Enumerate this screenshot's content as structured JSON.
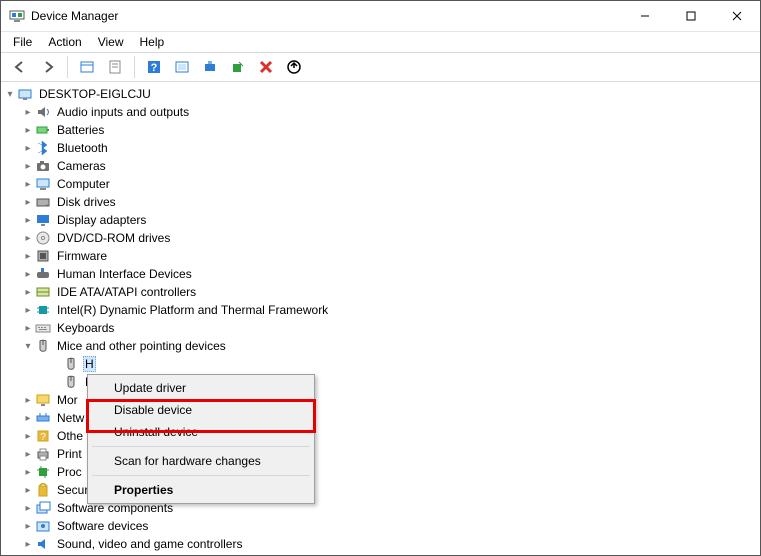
{
  "window": {
    "title": "Device Manager"
  },
  "menubar": [
    "File",
    "Action",
    "View",
    "Help"
  ],
  "toolbar_icons": [
    "back",
    "forward",
    "show-hidden",
    "properties",
    "help",
    "refresh",
    "update-driver",
    "scan",
    "uninstall",
    "safely-remove"
  ],
  "root_node": "DESKTOP-EIGLCJU",
  "categories": [
    {
      "label": "Audio inputs and outputs",
      "icon": "speaker",
      "expandable": true
    },
    {
      "label": "Batteries",
      "icon": "battery",
      "expandable": true
    },
    {
      "label": "Bluetooth",
      "icon": "bluetooth",
      "expandable": true
    },
    {
      "label": "Cameras",
      "icon": "camera",
      "expandable": true
    },
    {
      "label": "Computer",
      "icon": "computer",
      "expandable": true
    },
    {
      "label": "Disk drives",
      "icon": "disk",
      "expandable": true
    },
    {
      "label": "Display adapters",
      "icon": "display",
      "expandable": true
    },
    {
      "label": "DVD/CD-ROM drives",
      "icon": "cd",
      "expandable": true
    },
    {
      "label": "Firmware",
      "icon": "firmware",
      "expandable": true
    },
    {
      "label": "Human Interface Devices",
      "icon": "hid",
      "expandable": true
    },
    {
      "label": "IDE ATA/ATAPI controllers",
      "icon": "ide",
      "expandable": true
    },
    {
      "label": "Intel(R) Dynamic Platform and Thermal Framework",
      "icon": "chip",
      "expandable": true
    },
    {
      "label": "Keyboards",
      "icon": "keyboard",
      "expandable": true
    },
    {
      "label": "Mice and other pointing devices",
      "icon": "mouse",
      "expandable": true,
      "expanded": true,
      "children": [
        {
          "label": "H",
          "icon": "mouse",
          "selected": true
        },
        {
          "label": "P",
          "icon": "mouse"
        }
      ]
    },
    {
      "label": "Mor",
      "icon": "monitor",
      "expandable": true
    },
    {
      "label": "Netw",
      "icon": "network",
      "expandable": true
    },
    {
      "label": "Othe",
      "icon": "other",
      "expandable": true
    },
    {
      "label": "Print",
      "icon": "printer",
      "expandable": true
    },
    {
      "label": "Proc",
      "icon": "processor",
      "expandable": true
    },
    {
      "label": "Security devices",
      "icon": "security",
      "expandable": true
    },
    {
      "label": "Software components",
      "icon": "sw-comp",
      "expandable": true
    },
    {
      "label": "Software devices",
      "icon": "sw-dev",
      "expandable": true
    },
    {
      "label": "Sound, video and game controllers",
      "icon": "sound",
      "expandable": true
    }
  ],
  "context_menu": {
    "items": [
      {
        "label": "Update driver"
      },
      {
        "label": "Disable device",
        "highlight": true
      },
      {
        "label": "Uninstall device"
      },
      {
        "sep": true
      },
      {
        "label": "Scan for hardware changes"
      },
      {
        "sep": true
      },
      {
        "label": "Properties",
        "bold": true
      }
    ]
  }
}
